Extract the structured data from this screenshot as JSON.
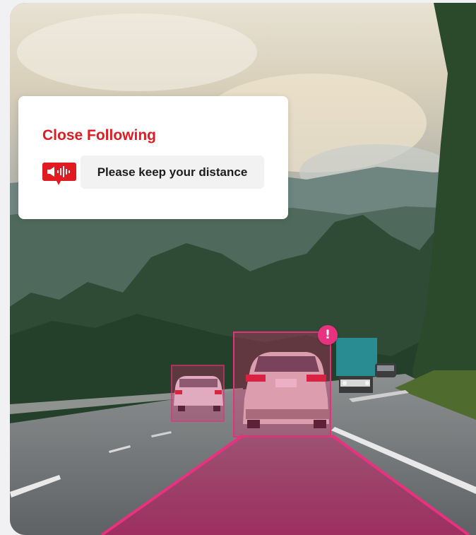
{
  "alert": {
    "title": "Close Following",
    "message": "Please keep your distance",
    "icon": "speaker-alert-icon",
    "title_color": "#e01b22"
  },
  "detections": {
    "warning_badge": "!",
    "accent_color": "#e5317c"
  }
}
